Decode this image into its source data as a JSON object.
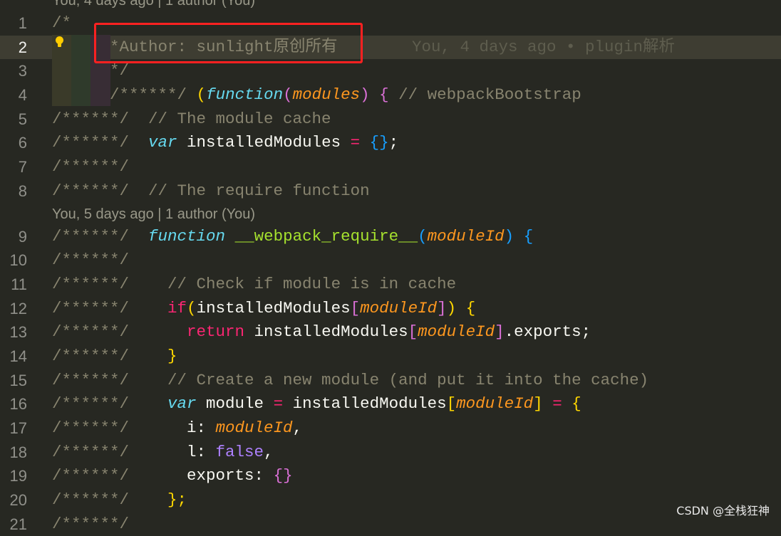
{
  "theme_colors": {
    "background": "#272822",
    "current_line": "#3e3d32",
    "comment": "#88846f",
    "highlight_box": "#ff2121"
  },
  "codelens": [
    {
      "before_line": 1,
      "text": "You, 4 days ago | 1 author (You)"
    },
    {
      "before_line": 9,
      "text": "You, 5 days ago | 1 author (You)"
    }
  ],
  "current_line": 2,
  "blame": {
    "line": 2,
    "text": "You, 4 days ago • plugin解析"
  },
  "lightbulb_icon": "lightbulb-icon",
  "code": {
    "lines": [
      {
        "n": "1",
        "tokens": [
          [
            "/*",
            "c"
          ]
        ]
      },
      {
        "n": "2",
        "tokens": [
          [
            "      *Author: sunlight原创所有",
            "c"
          ]
        ]
      },
      {
        "n": "3",
        "tokens": [
          [
            "      */",
            "c"
          ]
        ]
      },
      {
        "n": "4",
        "tokens": [
          [
            "      /******/ ",
            "c"
          ],
          [
            "(",
            "b1"
          ],
          [
            "function",
            "s"
          ],
          [
            "(",
            "b2"
          ],
          [
            "modules",
            "p"
          ],
          [
            ")",
            "b2"
          ],
          [
            " ",
            "t"
          ],
          [
            "{",
            "b2"
          ],
          [
            " // webpackBootstrap",
            "c"
          ]
        ]
      },
      {
        "n": "5",
        "tokens": [
          [
            "/******/  // The module cache",
            "c"
          ]
        ]
      },
      {
        "n": "6",
        "tokens": [
          [
            "/******/  ",
            "c"
          ],
          [
            "var",
            "s"
          ],
          [
            " installedModules ",
            "t"
          ],
          [
            "=",
            "o"
          ],
          [
            " ",
            "t"
          ],
          [
            "{}",
            "b3"
          ],
          [
            ";",
            "t"
          ]
        ]
      },
      {
        "n": "7",
        "tokens": [
          [
            "/******/",
            "c"
          ]
        ]
      },
      {
        "n": "8",
        "tokens": [
          [
            "/******/  // The require function",
            "c"
          ]
        ]
      },
      {
        "n": "9",
        "tokens": [
          [
            "/******/  ",
            "c"
          ],
          [
            "function",
            "s"
          ],
          [
            " ",
            "t"
          ],
          [
            "__webpack_require__",
            "f"
          ],
          [
            "(",
            "b3"
          ],
          [
            "moduleId",
            "p"
          ],
          [
            ")",
            "b3"
          ],
          [
            " ",
            "t"
          ],
          [
            "{",
            "b3"
          ]
        ]
      },
      {
        "n": "10",
        "tokens": [
          [
            "/******/",
            "c"
          ]
        ]
      },
      {
        "n": "11",
        "tokens": [
          [
            "/******/    // Check if module is in cache",
            "c"
          ]
        ]
      },
      {
        "n": "12",
        "tokens": [
          [
            "/******/    ",
            "c"
          ],
          [
            "if",
            "k"
          ],
          [
            "(",
            "b1"
          ],
          [
            "installedModules",
            "t"
          ],
          [
            "[",
            "b2"
          ],
          [
            "moduleId",
            "p"
          ],
          [
            "]",
            "b2"
          ],
          [
            ")",
            "b1"
          ],
          [
            " ",
            "t"
          ],
          [
            "{",
            "b1"
          ]
        ]
      },
      {
        "n": "13",
        "tokens": [
          [
            "/******/      ",
            "c"
          ],
          [
            "return",
            "k"
          ],
          [
            " installedModules",
            "t"
          ],
          [
            "[",
            "b2"
          ],
          [
            "moduleId",
            "p"
          ],
          [
            "]",
            "b2"
          ],
          [
            ".exports;",
            "t"
          ]
        ]
      },
      {
        "n": "14",
        "tokens": [
          [
            "/******/    ",
            "c"
          ],
          [
            "}",
            "b1"
          ]
        ]
      },
      {
        "n": "15",
        "tokens": [
          [
            "/******/    // Create a new module (and put it into the cache)",
            "c"
          ]
        ]
      },
      {
        "n": "16",
        "tokens": [
          [
            "/******/    ",
            "c"
          ],
          [
            "var",
            "s"
          ],
          [
            " module ",
            "t"
          ],
          [
            "=",
            "o"
          ],
          [
            " installedModules",
            "t"
          ],
          [
            "[",
            "b1"
          ],
          [
            "moduleId",
            "p"
          ],
          [
            "]",
            "b1"
          ],
          [
            " ",
            "t"
          ],
          [
            "=",
            "o"
          ],
          [
            " ",
            "t"
          ],
          [
            "{",
            "b1"
          ]
        ]
      },
      {
        "n": "17",
        "tokens": [
          [
            "/******/      ",
            "c"
          ],
          [
            "i: ",
            "t"
          ],
          [
            "moduleId",
            "p"
          ],
          [
            ",",
            "t"
          ]
        ]
      },
      {
        "n": "18",
        "tokens": [
          [
            "/******/      ",
            "c"
          ],
          [
            "l: ",
            "t"
          ],
          [
            "false",
            "n"
          ],
          [
            ",",
            "t"
          ]
        ]
      },
      {
        "n": "19",
        "tokens": [
          [
            "/******/      ",
            "c"
          ],
          [
            "exports: ",
            "t"
          ],
          [
            "{}",
            "b2"
          ]
        ]
      },
      {
        "n": "20",
        "tokens": [
          [
            "/******/    ",
            "c"
          ],
          [
            "};",
            "b1"
          ]
        ]
      },
      {
        "n": "21",
        "tokens": [
          [
            "/******/",
            "c"
          ]
        ]
      }
    ]
  },
  "watermark": "CSDN @全栈狂神"
}
